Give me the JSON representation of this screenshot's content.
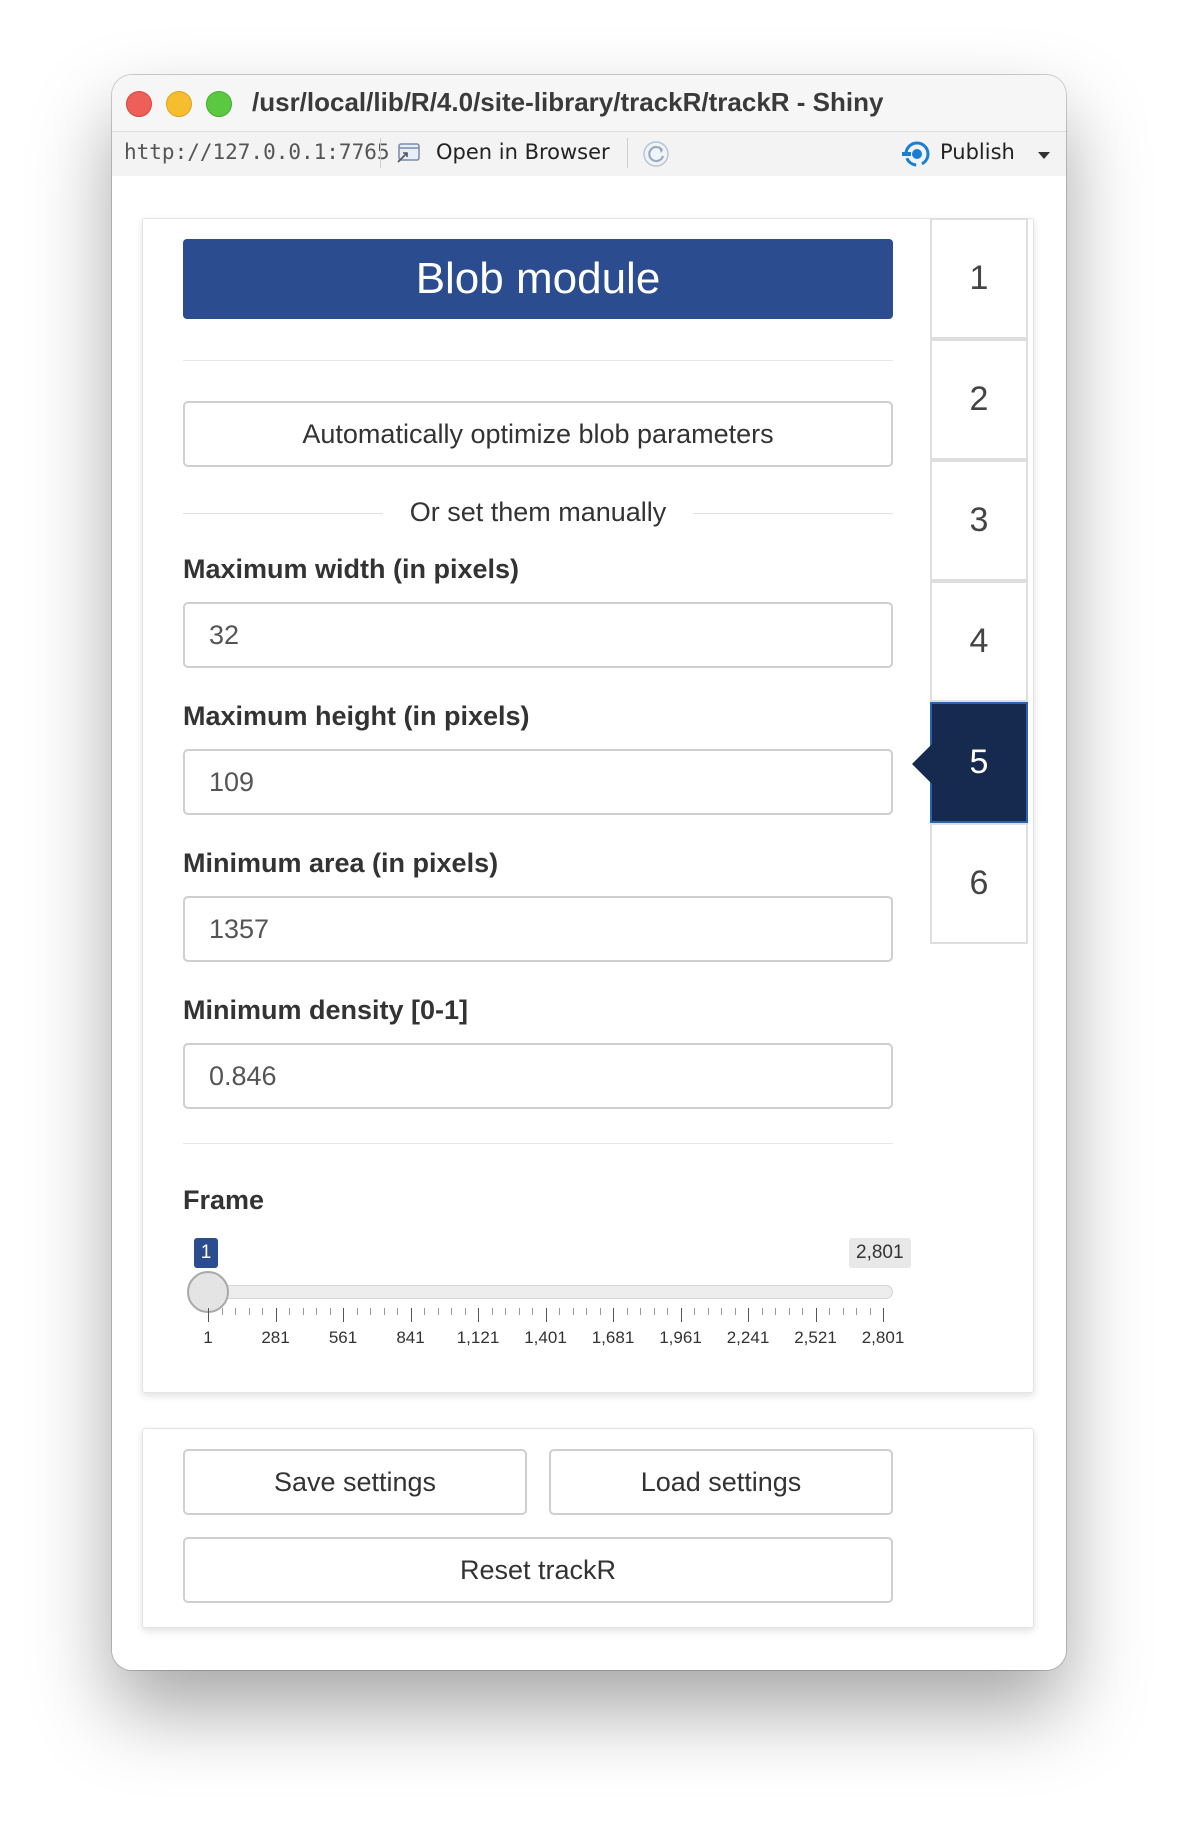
{
  "window": {
    "title": "/usr/local/lib/R/4.0/site-library/trackR/trackR - Shiny"
  },
  "toolbar": {
    "url": "http://127.0.0.1:7765",
    "open_in_browser": "Open in Browser",
    "publish": "Publish"
  },
  "module": {
    "title": "Blob module",
    "optimize_button": "Automatically optimize blob parameters",
    "manual_divider": "Or set them manually"
  },
  "fields": {
    "max_width": {
      "label": "Maximum width (in pixels)",
      "value": "32"
    },
    "max_height": {
      "label": "Maximum height (in pixels)",
      "value": "109"
    },
    "min_area": {
      "label": "Minimum area (in pixels)",
      "value": "1357"
    },
    "min_density": {
      "label": "Minimum density [0-1]",
      "value": "0.846"
    }
  },
  "frame": {
    "label": "Frame",
    "value": "1",
    "max": "2,801",
    "tick_labels": [
      "1",
      "281",
      "561",
      "841",
      "1,121",
      "1,401",
      "1,681",
      "1,961",
      "2,241",
      "2,521",
      "2,801"
    ]
  },
  "tabs": [
    "1",
    "2",
    "3",
    "4",
    "5",
    "6"
  ],
  "active_tab": "5",
  "actions": {
    "save": "Save settings",
    "load": "Load settings",
    "reset": "Reset trackR"
  },
  "colors": {
    "title_bg": "#2b4c8f",
    "active_tab_bg": "#162a4f",
    "publish_icon": "#1a7fd1"
  }
}
